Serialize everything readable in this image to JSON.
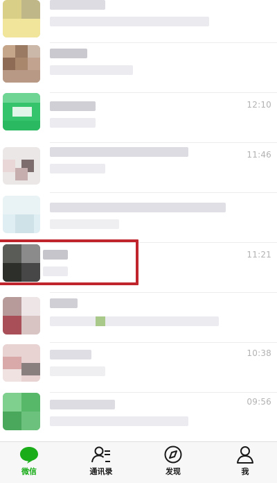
{
  "chats": [
    {
      "time": ""
    },
    {
      "time": ""
    },
    {
      "time": "12:10"
    },
    {
      "time": "11:46"
    },
    {
      "time": ""
    },
    {
      "time": "11:21"
    },
    {
      "time": ""
    },
    {
      "time": "10:38"
    },
    {
      "time": "09:56"
    }
  ],
  "tabbar": {
    "tabs": [
      {
        "label": "微信",
        "icon": "chat-bubble-icon",
        "active": true
      },
      {
        "label": "通讯录",
        "icon": "contacts-icon",
        "active": false
      },
      {
        "label": "发现",
        "icon": "compass-icon",
        "active": false
      },
      {
        "label": "我",
        "icon": "person-icon",
        "active": false
      }
    ]
  },
  "colors": {
    "accent": "#1aad19",
    "highlight": "#c0242d",
    "time_text": "#b2b2b2"
  }
}
